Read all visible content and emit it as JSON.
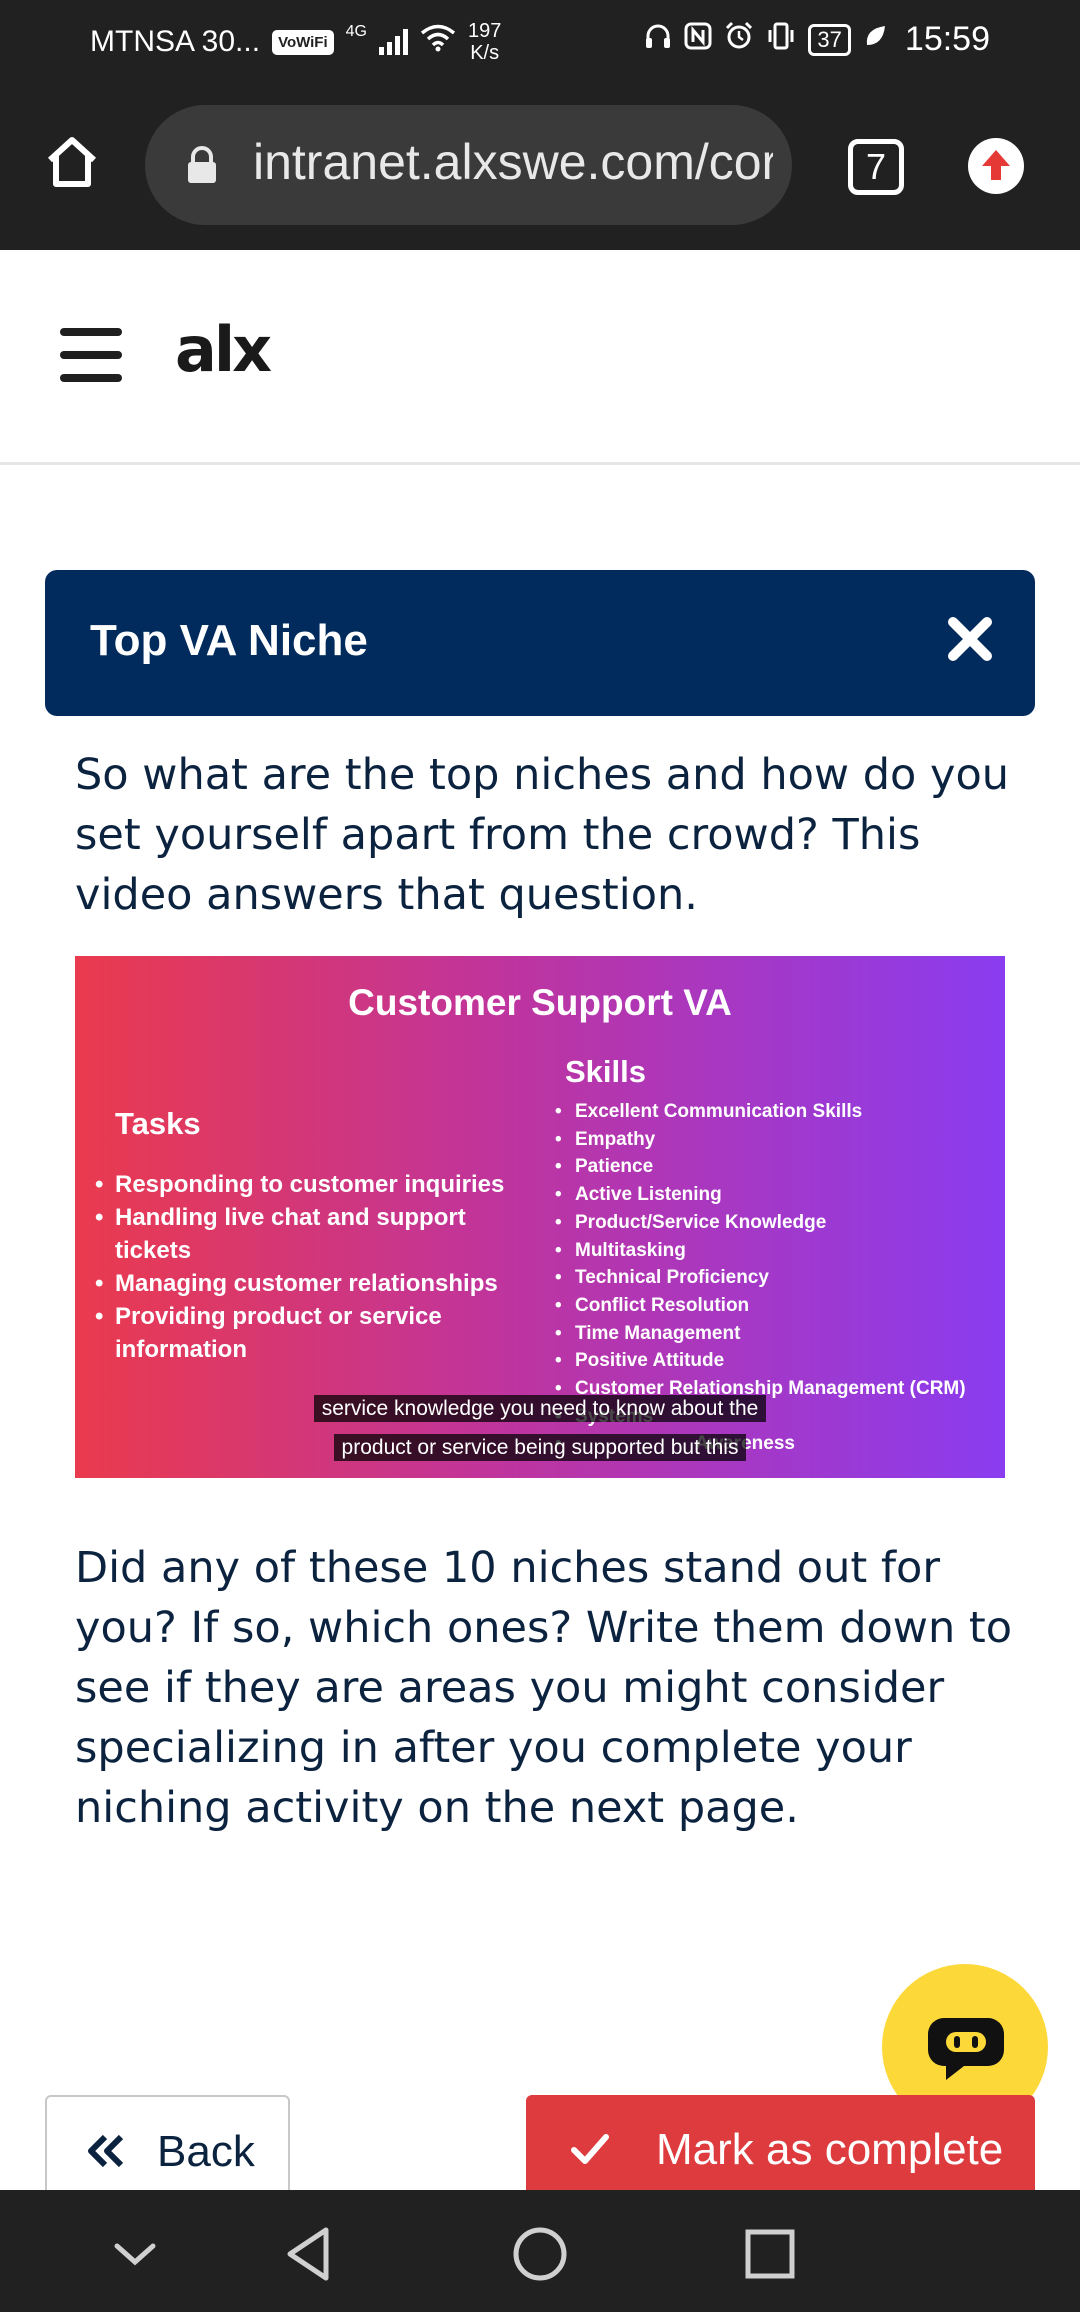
{
  "status_bar": {
    "carrier": "MTNSA 30...",
    "vowifi": "VoWiFi",
    "network": "4G",
    "speed_value": "197",
    "speed_unit": "K/s",
    "battery": "37",
    "time": "15:59",
    "icons": [
      "headphones-icon",
      "nfc-icon",
      "alarm-icon",
      "vibrate-icon",
      "battery-icon",
      "leaf-icon"
    ]
  },
  "browser": {
    "url": "intranet.alxswe.com/cor",
    "tab_count": "7"
  },
  "site": {
    "logo": "alx"
  },
  "lesson": {
    "header_title": "Top VA Niche",
    "intro": "So what are the top niches and how do you set yourself apart from the crowd? This video answers that question.",
    "outro": "Did any of these 10 niches stand out for you? If so, which ones? Write them down to see if they are areas you might consider specializing in after you complete your niching activity on the next page."
  },
  "video": {
    "title": "Customer Support VA",
    "tasks_heading": "Tasks",
    "tasks": [
      "Responding to customer inquiries",
      "Handling live chat and support tickets",
      "Managing customer relationships",
      "Providing product or service information"
    ],
    "skills_heading": "Skills",
    "skills": [
      "Excellent Communication Skills",
      "Empathy",
      "Patience",
      "Active Listening",
      "Product/Service Knowledge",
      "Multitasking",
      "Technical Proficiency",
      "Conflict Resolution",
      "Time Management",
      "Positive Attitude",
      "Customer Relationship Management (CRM)",
      "Systems",
      "Awareness"
    ],
    "caption_line1": "service knowledge you need to know about the",
    "caption_line2": "product or service being supported but this"
  },
  "actions": {
    "back_label": "Back",
    "complete_label": "Mark as complete"
  },
  "colors": {
    "header_bg": "#002b5c",
    "text": "#0c2340",
    "complete_bg": "#de3b3f",
    "chat_bg": "#fcd839"
  }
}
